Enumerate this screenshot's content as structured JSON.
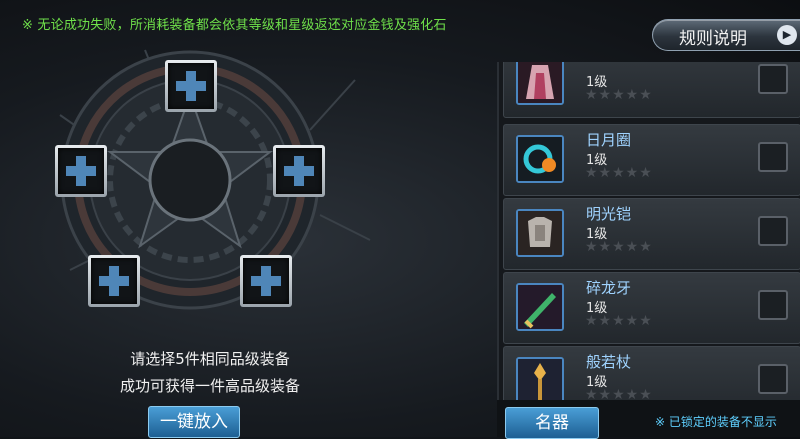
{
  "notice": "※ 无论成功失败，所消耗装备都会依其等级和星级返还对应金钱及强化石",
  "rules_button": {
    "label": "规则说明",
    "icon": "play-icon"
  },
  "altar": {
    "slot_icon": "plus-icon",
    "hint_line1": "请选择5件相同品级装备",
    "hint_line2": "成功可获得一件高品级装备"
  },
  "fill_button": "一键放入",
  "items": [
    {
      "name": "",
      "level": "1级",
      "stars": "★★★★★"
    },
    {
      "name": "日月圈",
      "level": "1级",
      "stars": "★★★★★"
    },
    {
      "name": "明光铠",
      "level": "1级",
      "stars": "★★★★★"
    },
    {
      "name": "碎龙牙",
      "level": "1级",
      "stars": "★★★★★"
    },
    {
      "name": "般若杖",
      "level": "1级",
      "stars": "★★★★★"
    }
  ],
  "tab_button": "名器",
  "lock_note": "※ 已锁定的装备不显示",
  "colors": {
    "notice": "#6fe04a",
    "accent_button": "#2a7fc0",
    "item_name": "#9fd3ff"
  }
}
